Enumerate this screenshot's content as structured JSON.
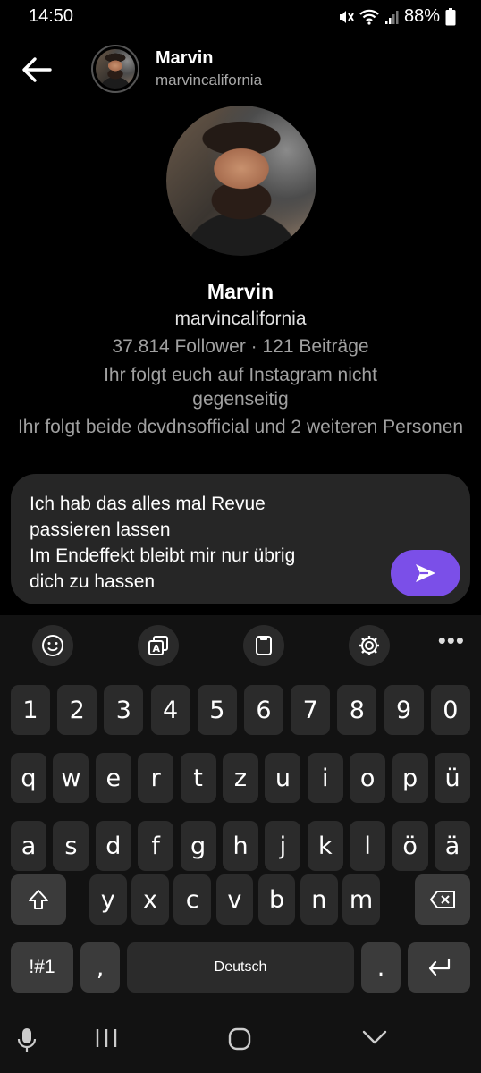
{
  "status_bar": {
    "time": "14:50",
    "battery": "88%",
    "icons": [
      "mute-icon",
      "wifi-icon",
      "signal-icon",
      "battery-icon"
    ]
  },
  "header": {
    "name": "Marvin",
    "handle": "marvincalifornia"
  },
  "profile": {
    "name": "Marvin",
    "handle": "marvincalifornia",
    "stats": "37.814 Follower · 121 Beiträge",
    "mutual_note": "Ihr folgt euch auf Instagram nicht gegenseitig",
    "followed_by": "Ihr folgt beide dcvdnsofficial und 2 weiteren Personen"
  },
  "composer": {
    "text": "Ich hab das alles mal Revue\npassieren lassen\nIm Endeffekt bleibt mir nur übrig\ndich zu hassen",
    "accent": "#7b4fe8"
  },
  "keyboard": {
    "toolbar": [
      "emoji-icon",
      "clipboard-translate-icon",
      "clipboard-icon",
      "settings-icon",
      "more-icon"
    ],
    "rows": [
      [
        "1",
        "2",
        "3",
        "4",
        "5",
        "6",
        "7",
        "8",
        "9",
        "0"
      ],
      [
        "q",
        "w",
        "e",
        "r",
        "t",
        "z",
        "u",
        "i",
        "o",
        "p",
        "ü"
      ],
      [
        "a",
        "s",
        "d",
        "f",
        "g",
        "h",
        "j",
        "k",
        "l",
        "ö",
        "ä"
      ],
      [
        "y",
        "x",
        "c",
        "v",
        "b",
        "n",
        "m"
      ]
    ],
    "symbols_label": "!#1",
    "comma": ",",
    "space_label": "Deutsch",
    "period": "."
  },
  "nav_bar": [
    "mic-icon",
    "recents-icon",
    "home-icon",
    "back-icon"
  ]
}
